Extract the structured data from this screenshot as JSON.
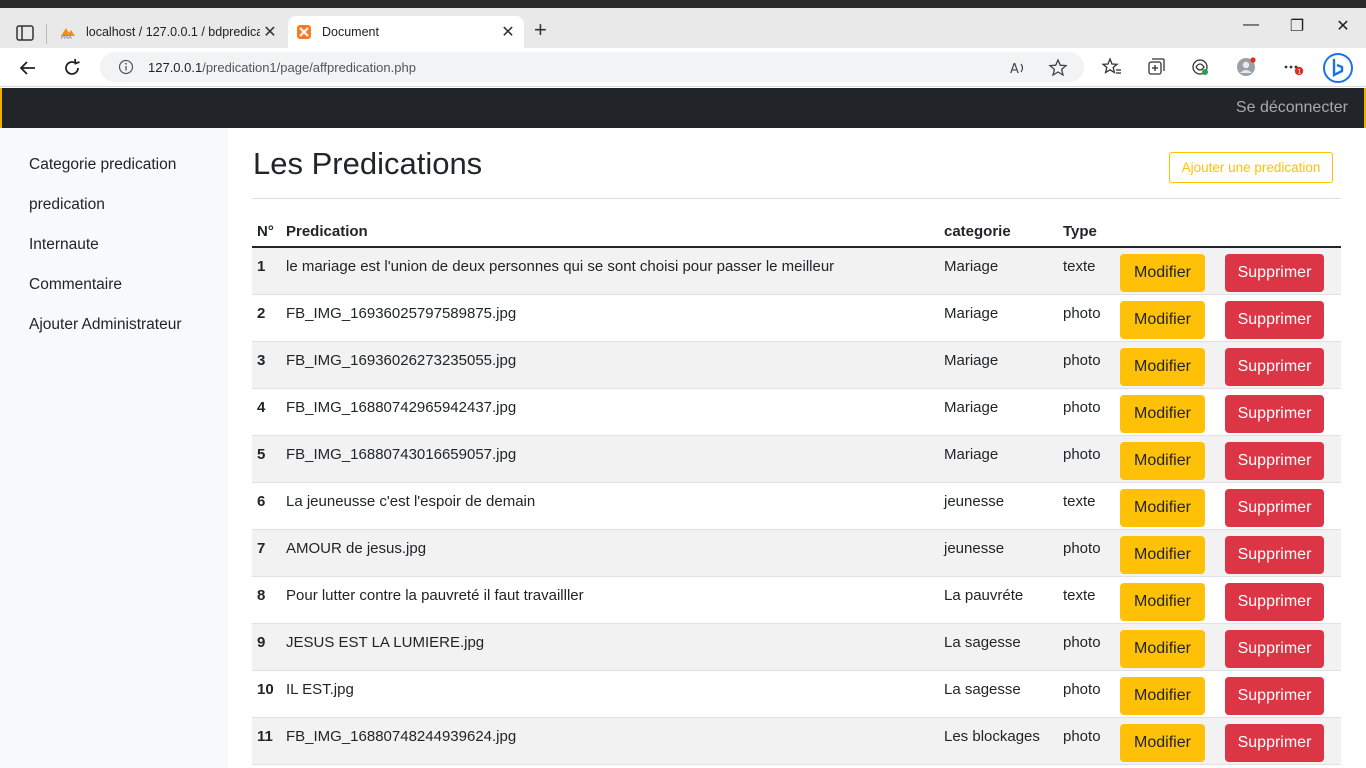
{
  "browser": {
    "tabs": [
      {
        "title": "localhost / 127.0.0.1 / bdpredicat"
      },
      {
        "title": "Document"
      }
    ],
    "url_host": "127.0.0.1",
    "url_path": "/predication1/page/affpredication.php"
  },
  "navbar": {
    "logout_label": "Se déconnecter"
  },
  "sidebar": {
    "items": [
      {
        "label": "Categorie predication"
      },
      {
        "label": "predication"
      },
      {
        "label": "Internaute"
      },
      {
        "label": "Commentaire"
      },
      {
        "label": "Ajouter Administrateur"
      }
    ]
  },
  "main": {
    "title": "Les Predications",
    "add_label": "Ajouter une predication",
    "table": {
      "headers": {
        "num": "N°",
        "pred": "Predication",
        "cat": "categorie",
        "type": "Type"
      },
      "modify_label": "Modifier",
      "delete_label": "Supprimer",
      "rows": [
        {
          "num": "1",
          "pred": "le mariage est l'union de deux personnes qui se sont choisi pour passer le meilleur",
          "cat": "Mariage",
          "type": "texte"
        },
        {
          "num": "2",
          "pred": "FB_IMG_16936025797589875.jpg",
          "cat": "Mariage",
          "type": "photo"
        },
        {
          "num": "3",
          "pred": "FB_IMG_16936026273235055.jpg",
          "cat": "Mariage",
          "type": "photo"
        },
        {
          "num": "4",
          "pred": "FB_IMG_16880742965942437.jpg",
          "cat": "Mariage",
          "type": "photo"
        },
        {
          "num": "5",
          "pred": "FB_IMG_16880743016659057.jpg",
          "cat": "Mariage",
          "type": "photo"
        },
        {
          "num": "6",
          "pred": "La jeuneusse c'est l'espoir de demain",
          "cat": "jeunesse",
          "type": "texte"
        },
        {
          "num": "7",
          "pred": "AMOUR de jesus.jpg",
          "cat": "jeunesse",
          "type": "photo"
        },
        {
          "num": "8",
          "pred": "Pour lutter contre la pauvreté il faut travailller",
          "cat": "La pauvréte",
          "type": "texte"
        },
        {
          "num": "9",
          "pred": "JESUS EST LA LUMIERE.jpg",
          "cat": "La sagesse",
          "type": "photo"
        },
        {
          "num": "10",
          "pred": "IL EST.jpg",
          "cat": "La sagesse",
          "type": "photo"
        },
        {
          "num": "11",
          "pred": "FB_IMG_16880748244939624.jpg",
          "cat": "Les blockages",
          "type": "photo"
        }
      ]
    }
  },
  "colors": {
    "warning": "#ffc107",
    "danger": "#dc3545",
    "dark": "#212529"
  }
}
